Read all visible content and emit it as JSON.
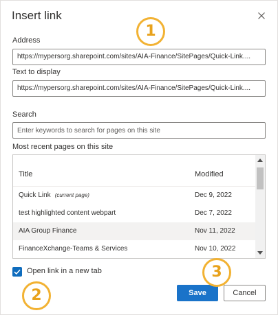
{
  "dialog": {
    "title": "Insert link",
    "close_icon": "close-icon"
  },
  "address": {
    "label": "Address",
    "value": "https://mypersorg.sharepoint.com/sites/AIA-Finance/SitePages/Quick-Link...."
  },
  "display_text": {
    "label": "Text to display",
    "value": "https://mypersorg.sharepoint.com/sites/AIA-Finance/SitePages/Quick-Link...."
  },
  "search": {
    "label": "Search",
    "placeholder": "Enter keywords to search for pages on this site"
  },
  "recent": {
    "label": "Most recent pages on this site",
    "columns": {
      "title": "Title",
      "modified": "Modified"
    },
    "rows": [
      {
        "title": "Quick Link",
        "note": "(current page)",
        "modified": "Dec 9, 2022",
        "selected": false
      },
      {
        "title": "test highlighted content webpart",
        "note": "",
        "modified": "Dec 7, 2022",
        "selected": false
      },
      {
        "title": "AIA Group Finance",
        "note": "",
        "modified": "Nov 11, 2022",
        "selected": true
      },
      {
        "title": "FinanceXchange-Teams & Services",
        "note": "",
        "modified": "Nov 10, 2022",
        "selected": false
      }
    ]
  },
  "new_tab": {
    "label": "Open link in a new tab",
    "checked": true
  },
  "buttons": {
    "save": "Save",
    "cancel": "Cancel"
  },
  "callouts": [
    "1",
    "2",
    "3"
  ],
  "colors": {
    "primary": "#1a73c9",
    "callout": "#f2b233",
    "checkbox": "#0f6cbd"
  }
}
